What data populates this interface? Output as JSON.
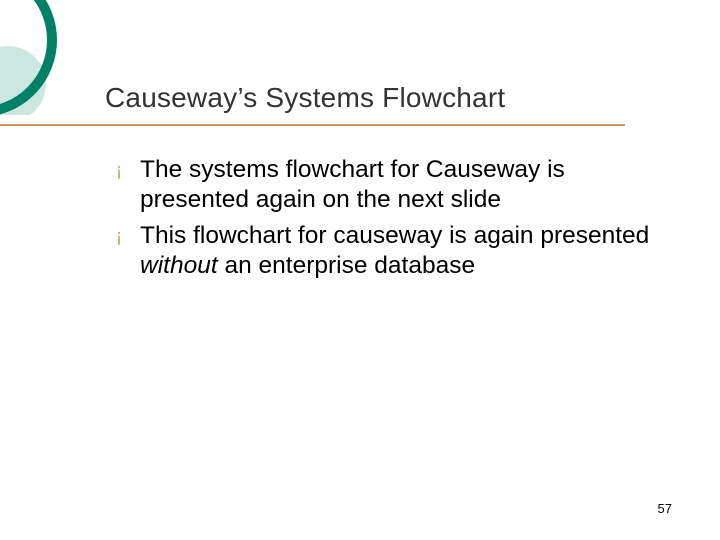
{
  "title": "Causeway’s Systems Flowchart",
  "bullets": [
    {
      "pre": "The systems flowchart for Causeway is presented again on the next slide",
      "em": "",
      "post": ""
    },
    {
      "pre": "This flowchart for causeway is again presented ",
      "em": "without",
      "post": " an enterprise database"
    }
  ],
  "page_number": "57",
  "bullet_glyph": "¡",
  "accent_color": "#cc9966",
  "graphic_color": "#008066"
}
